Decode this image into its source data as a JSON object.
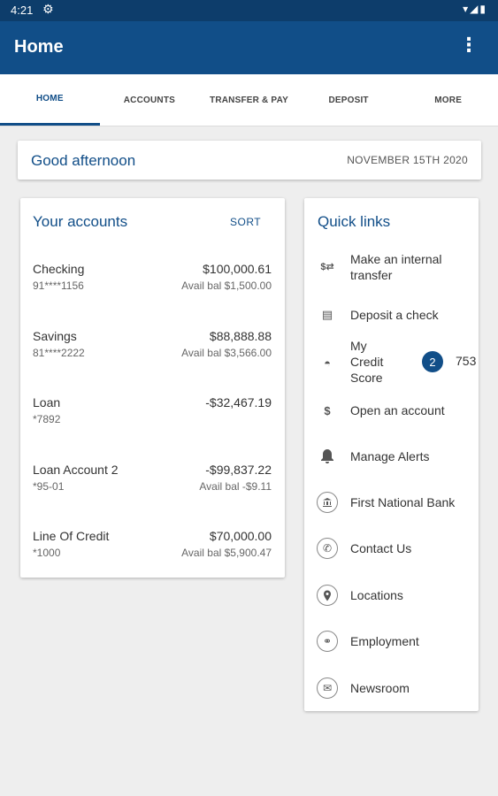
{
  "status_bar": {
    "time": "4:21",
    "gear_icon": "gear-icon",
    "system_icons": "▾◢▮"
  },
  "app_bar": {
    "title": "Home",
    "menu_icon": "⋮"
  },
  "tabs": [
    {
      "label": "HOME",
      "active": true
    },
    {
      "label": "ACCOUNTS",
      "active": false
    },
    {
      "label": "TRANSFER & PAY",
      "active": false
    },
    {
      "label": "DEPOSIT",
      "active": false
    },
    {
      "label": "MORE",
      "active": false
    }
  ],
  "greeting": {
    "text": "Good afternoon",
    "date": "NOVEMBER 15TH 2020"
  },
  "accounts": {
    "heading": "Your accounts",
    "sort_label": "SORT",
    "items": [
      {
        "name": "Checking",
        "number": "91****1156",
        "balance": "$100,000.61",
        "available": "Avail bal $1,500.00"
      },
      {
        "name": "Savings",
        "number": "81****2222",
        "balance": "$88,888.88",
        "available": "Avail bal $3,566.00"
      },
      {
        "name": "Loan",
        "number": "*7892",
        "balance": "-$32,467.19",
        "available": ""
      },
      {
        "name": "Loan Account 2",
        "number": "*95-01",
        "balance": "-$99,837.22",
        "available": "Avail bal -$9.11"
      },
      {
        "name": "Line Of Credit",
        "number": "*1000",
        "balance": "$70,000.00",
        "available": "Avail bal $5,900.47"
      }
    ]
  },
  "quick_links": {
    "heading": "Quick links",
    "items": [
      {
        "label": "Make an internal transfer",
        "icon": "transfer-icon",
        "glyph": "$⇄"
      },
      {
        "label": "Deposit a check",
        "icon": "check-icon",
        "glyph": "▤"
      },
      {
        "label": "My Credit Score",
        "icon": "gauge-icon",
        "glyph": "◓"
      },
      {
        "label": "Open an account",
        "icon": "money-plus-icon",
        "glyph": "$"
      },
      {
        "label": "Manage Alerts",
        "icon": "bell-icon",
        "glyph": "🔔"
      },
      {
        "label": "First National Bank",
        "icon": "bank-icon",
        "glyph": "🏛"
      },
      {
        "label": "Contact Us",
        "icon": "phone-icon",
        "glyph": "✆"
      },
      {
        "label": "Locations",
        "icon": "pin-icon",
        "glyph": "⌖"
      },
      {
        "label": "Employment",
        "icon": "handshake-icon",
        "glyph": "⚭"
      },
      {
        "label": "Newsroom",
        "icon": "mail-icon",
        "glyph": "✉"
      }
    ],
    "credit_badge": "2",
    "credit_score": "753"
  },
  "colors": {
    "brand": "#114e88",
    "status_bar": "#0d3d6b",
    "background": "#eeeeee"
  }
}
